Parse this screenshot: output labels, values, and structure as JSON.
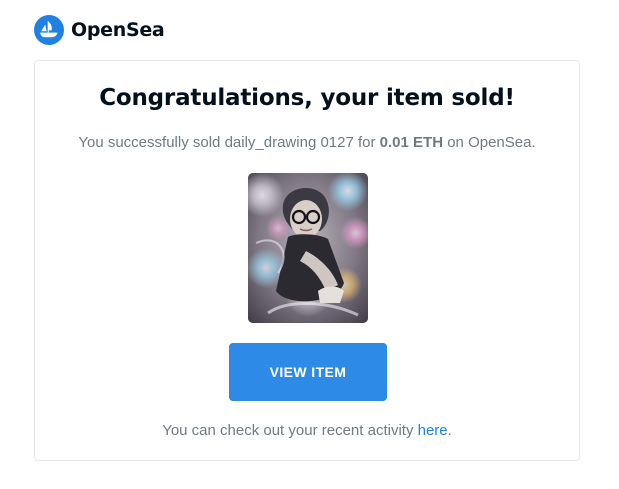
{
  "brand": {
    "name": "OpenSea",
    "accent_color": "#2081e2"
  },
  "email": {
    "headline": "Congratulations, your item sold!",
    "summary": {
      "prefix": "You successfully sold ",
      "item_name": "daily_drawing 0127",
      "mid": " for ",
      "price": "0.01 ETH",
      "suffix": " on OpenSea."
    },
    "artwork_icon": "nft-artwork-image",
    "button_label": "VIEW ITEM",
    "button_color": "#2d8ae6",
    "footer": {
      "prefix": "You can check out your recent activity ",
      "link_text": "here",
      "suffix": "."
    }
  }
}
